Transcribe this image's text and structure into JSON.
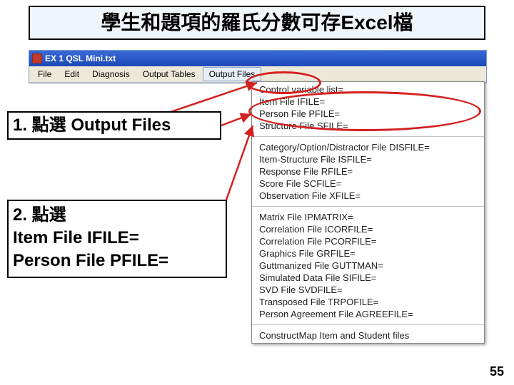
{
  "title": "學生和題項的羅氏分數可存Excel檔",
  "window_title": "EX 1 QSL Mini.txt",
  "menus": [
    "File",
    "Edit",
    "Diagnosis",
    "Output Tables",
    "Output Files"
  ],
  "dropdown": {
    "group1": [
      "Control variable list=",
      "Item File IFILE=",
      "Person File PFILE=",
      "Structure File SFILE="
    ],
    "group2": [
      "Category/Option/Distractor File DISFILE=",
      "Item-Structure File ISFILE=",
      "Response File RFILE=",
      "Score File SCFILE=",
      "Observation File XFILE="
    ],
    "group3": [
      "Matrix File IPMATRIX=",
      "Correlation File ICORFILE=",
      "Correlation File PCORFILE=",
      "Graphics File GRFILE=",
      "Guttmanized File GUTTMAN=",
      "Simulated Data File SIFILE=",
      "SVD File SVDFILE=",
      "Transposed File TRPOFILE=",
      "Person Agreement File AGREEFILE="
    ],
    "group4": [
      "ConstructMap Item and Student files"
    ]
  },
  "callout1": "1. 點選 Output Files",
  "callout2_l1": "2. 點選",
  "callout2_l2": "Item File IFILE=",
  "callout2_l3": "Person File PFILE=",
  "page_number": "55"
}
